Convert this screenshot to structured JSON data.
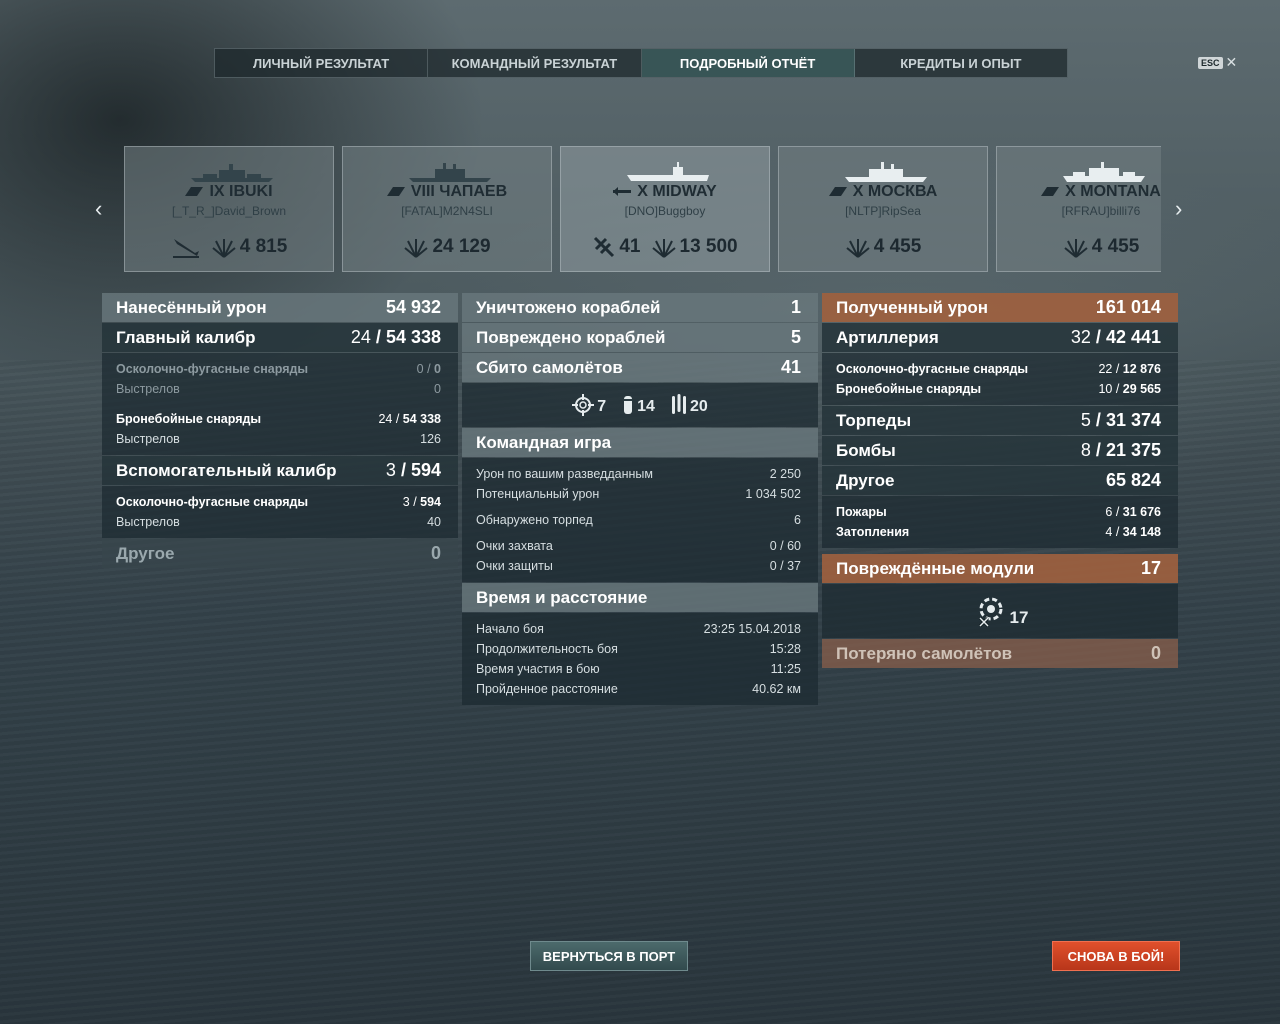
{
  "tabs": [
    {
      "label": "ЛИЧНЫЙ РЕЗУЛЬТАТ"
    },
    {
      "label": "КОМАНДНЫЙ РЕЗУЛЬТАТ"
    },
    {
      "label": "ПОДРОБНЫЙ ОТЧЁТ",
      "active": true
    },
    {
      "label": "КРЕДИТЫ И ОПЫТ"
    }
  ],
  "esc": {
    "key": "ESC",
    "close": "✕"
  },
  "nav": {
    "prev": "‹",
    "next": "›"
  },
  "ships": [
    {
      "name": "IX IBUKI",
      "player": "[_T_R_]David_Brown",
      "type": "cruiser",
      "stats": [
        {
          "icon": "sunk-ship-icon",
          "value": ""
        },
        {
          "icon": "explosion-damage-icon",
          "value": "4 815"
        }
      ]
    },
    {
      "name": "VIII ЧАПАЕВ",
      "player": "[FATAL]M2N4SLI",
      "type": "cruiser",
      "stats": [
        {
          "icon": "explosion-damage-icon",
          "value": "24 129"
        }
      ]
    },
    {
      "name": "X MIDWAY",
      "player": "[DNO]Buggboy",
      "type": "carrier",
      "selected": true,
      "stats": [
        {
          "icon": "plane-shot-down-icon",
          "value": "41"
        },
        {
          "icon": "explosion-damage-icon",
          "value": "13 500"
        }
      ]
    },
    {
      "name": "X МОСКВА",
      "player": "[NLTP]RipSea",
      "type": "cruiser",
      "stats": [
        {
          "icon": "explosion-damage-icon",
          "value": "4 455"
        }
      ]
    },
    {
      "name": "X MONTANA",
      "player": "[RFRAU]billi76",
      "type": "battleship",
      "stats": [
        {
          "icon": "explosion-damage-icon",
          "value": "4 455"
        }
      ]
    }
  ],
  "left": {
    "dealt": {
      "label": "Нанесённый урон",
      "value": "54 932"
    },
    "main": {
      "label": "Главный калибр",
      "a": "24",
      "b": "54 338"
    },
    "he": {
      "label": "Осколочно-фугасные снаряды",
      "a": "0",
      "b": "0"
    },
    "he_shots": {
      "label": "Выстрелов",
      "value": "0"
    },
    "ap": {
      "label": "Бронебойные снаряды",
      "a": "24",
      "b": "54 338"
    },
    "ap_shots": {
      "label": "Выстрелов",
      "value": "126"
    },
    "secondary": {
      "label": "Вспомогательный калибр",
      "a": "3",
      "b": "594"
    },
    "sec_he": {
      "label": "Осколочно-фугасные снаряды",
      "a": "3",
      "b": "594"
    },
    "sec_shots": {
      "label": "Выстрелов",
      "value": "40"
    },
    "other": {
      "label": "Другое",
      "value": "0"
    }
  },
  "center": {
    "destroyed": {
      "label": "Уничтожено кораблей",
      "value": "1"
    },
    "damaged": {
      "label": "Повреждено кораблей",
      "value": "5"
    },
    "planes": {
      "label": "Сбито самолётов",
      "value": "41"
    },
    "icons": [
      {
        "icon": "crosshair-icon",
        "value": "7"
      },
      {
        "icon": "bomb-icon",
        "value": "14"
      },
      {
        "icon": "torpedo-icon",
        "value": "20"
      }
    ],
    "team": {
      "label": "Командная игра"
    },
    "spot_dmg": {
      "label": "Урон по вашим разведданным",
      "value": "2 250"
    },
    "potential": {
      "label": "Потенциальный урон",
      "value": "1 034 502"
    },
    "torps_spotted": {
      "label": "Обнаружено торпед",
      "value": "6"
    },
    "capture": {
      "label": "Очки захвата",
      "value": "0 / 60"
    },
    "defense": {
      "label": "Очки защиты",
      "value": "0 / 37"
    },
    "time": {
      "label": "Время и расстояние"
    },
    "start": {
      "label": "Начало боя",
      "value": "23:25  15.04.2018"
    },
    "duration": {
      "label": "Продолжительность боя",
      "value": "15:28"
    },
    "participation": {
      "label": "Время участия в бою",
      "value": "11:25"
    },
    "distance": {
      "label": "Пройденное расстояние",
      "value": "40.62 км"
    }
  },
  "right": {
    "received": {
      "label": "Полученный урон",
      "value": "161 014"
    },
    "artillery": {
      "label": "Артиллерия",
      "a": "32",
      "b": "42 441"
    },
    "he": {
      "label": "Осколочно-фугасные снаряды",
      "a": "22",
      "b": "12 876"
    },
    "ap": {
      "label": "Бронебойные снаряды",
      "a": "10",
      "b": "29 565"
    },
    "torpedoes": {
      "label": "Торпеды",
      "a": "5",
      "b": "31 374"
    },
    "bombs": {
      "label": "Бомбы",
      "a": "8",
      "b": "21 375"
    },
    "other": {
      "label": "Другое",
      "value": "65 824"
    },
    "fires": {
      "label": "Пожары",
      "a": "6",
      "b": "31 676"
    },
    "floods": {
      "label": "Затопления",
      "a": "4",
      "b": "34 148"
    },
    "modules": {
      "label": "Повреждённые модули",
      "value": "17",
      "icon_value": "17"
    },
    "planes_lost": {
      "label": "Потеряно самолётов",
      "value": "0"
    }
  },
  "buttons": {
    "port": "ВЕРНУТЬСЯ В ПОРТ",
    "battle": "СНОВА В БОЙ!"
  },
  "colors": {
    "accent_brown": "#a0603e",
    "battle_button": "#d2452a",
    "active_tab": "#3c5f5f"
  }
}
